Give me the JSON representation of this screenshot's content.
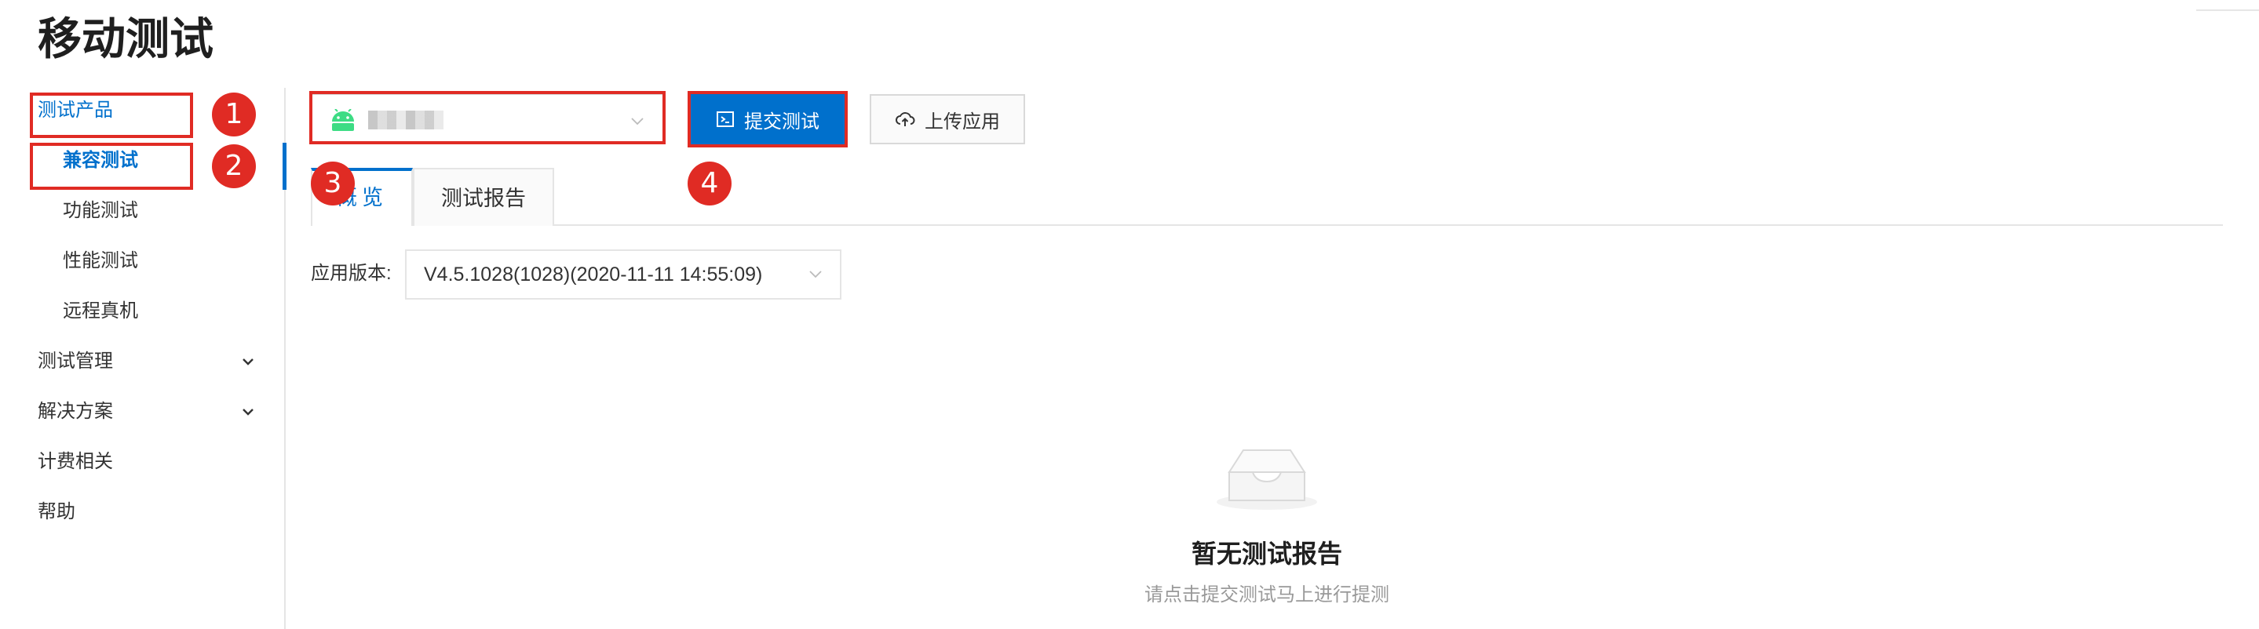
{
  "page": {
    "title": "移动测试"
  },
  "sidebar": {
    "items": [
      {
        "label": "测试产品"
      },
      {
        "label": "兼容测试"
      },
      {
        "label": "功能测试"
      },
      {
        "label": "性能测试"
      },
      {
        "label": "远程真机"
      },
      {
        "label": "测试管理"
      },
      {
        "label": "解决方案"
      },
      {
        "label": "计费相关"
      },
      {
        "label": "帮助"
      }
    ]
  },
  "toolbar": {
    "app_select_icon": "android-icon",
    "submit_label": "提交测试",
    "upload_label": "上传应用"
  },
  "tabs": [
    {
      "label": "概览"
    },
    {
      "label": "测试报告"
    }
  ],
  "filter": {
    "version_label": "应用版本:",
    "version_value": "V4.5.1028(1028)(2020-11-11 14:55:09)"
  },
  "empty_state": {
    "title": "暂无测试报告",
    "hint": "请点击提交测试马上进行提测"
  },
  "annotations": [
    "1",
    "2",
    "3",
    "4"
  ],
  "colors": {
    "accent": "#0070cc",
    "annotation": "#e02b24",
    "android": "#3ddc84"
  }
}
